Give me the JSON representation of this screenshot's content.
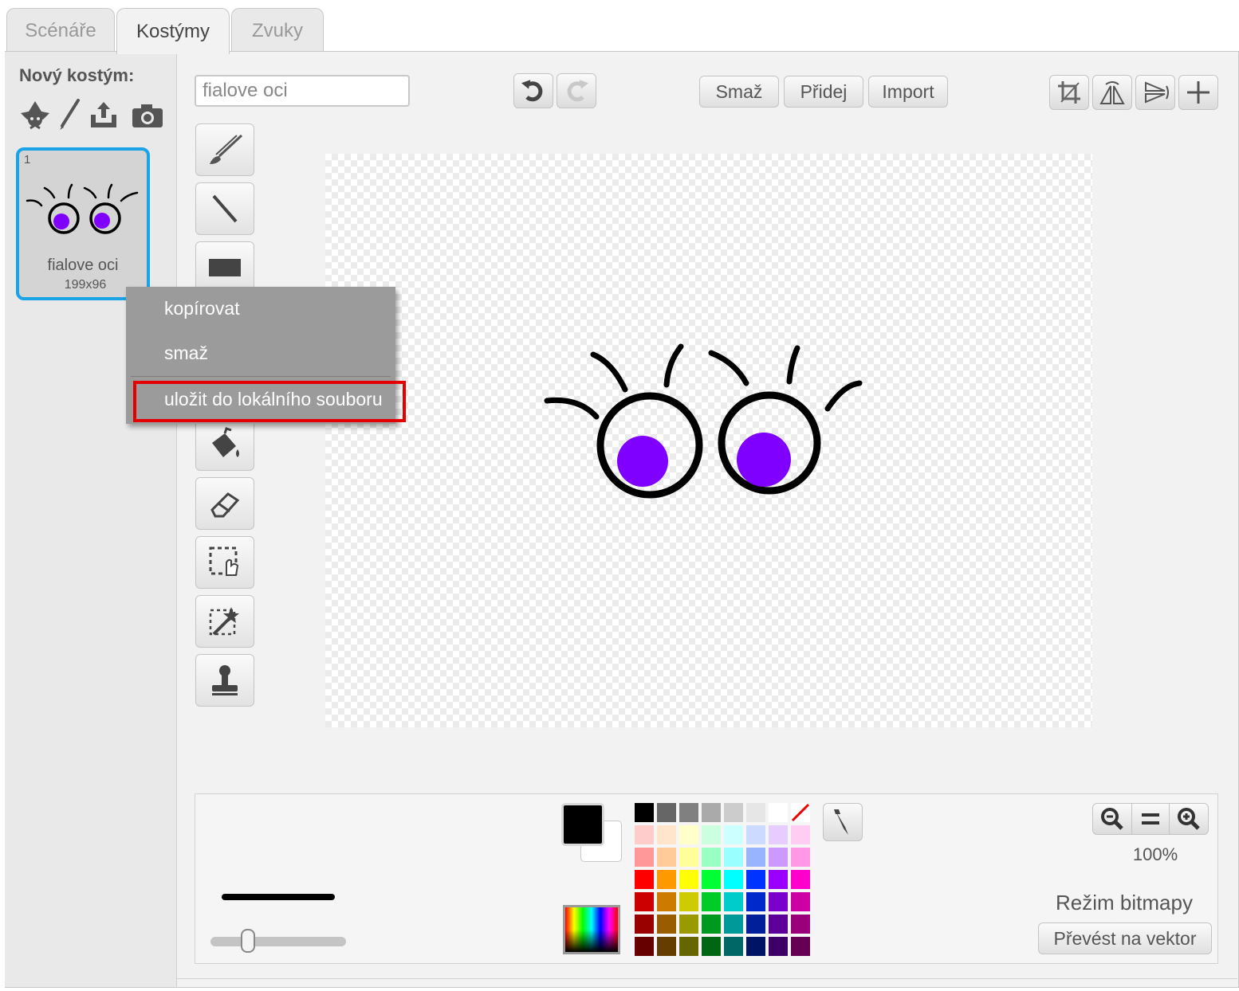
{
  "tabs": [
    {
      "label": "Scénáře"
    },
    {
      "label": "Kostýmy"
    },
    {
      "label": "Zvuky"
    }
  ],
  "new_costume": {
    "label": "Nový kostým:",
    "icons": [
      "sprite-library-icon",
      "paint-brush-icon",
      "upload-icon",
      "camera-icon"
    ]
  },
  "costume": {
    "number": "1",
    "name": "fialove oci",
    "size": "199x96"
  },
  "context_menu": {
    "items": [
      "kopírovat",
      "smaž",
      "uložit do lokálního souboru"
    ]
  },
  "toolbar": {
    "costume_name_value": "fialove oci",
    "clear_label": "Smaž",
    "add_label": "Přidej",
    "import_label": "Import"
  },
  "tools": [
    "brush-icon",
    "line-icon",
    "rectangle-icon",
    "ellipse-icon",
    "text-icon",
    "fill-icon",
    "eraser-icon",
    "select-icon",
    "magic-select-icon",
    "stamp-icon"
  ],
  "bottom": {
    "zoom": "100%",
    "mode_label": "Režim bitmapy",
    "convert_label": "Převést na vektor",
    "primary_color": "#000000",
    "secondary_color": "#ffffff"
  },
  "palette": [
    [
      "#000000",
      "#666666",
      "#808080",
      "#aaaaaa",
      "#cccccc",
      "#e6e6e6",
      "#ffffff",
      "none"
    ],
    [
      "#ffcccc",
      "#ffe5cc",
      "#ffffcc",
      "#ccffe0",
      "#ccffff",
      "#ccdaff",
      "#e6ccff",
      "#ffccf2"
    ],
    [
      "#ff9999",
      "#ffcc99",
      "#ffff99",
      "#99ffc2",
      "#99ffff",
      "#99b4ff",
      "#cc99ff",
      "#ff99e6"
    ],
    [
      "#ff0000",
      "#ff9900",
      "#ffff00",
      "#00ff33",
      "#00ffff",
      "#0033ff",
      "#9900ff",
      "#ff00cc"
    ],
    [
      "#cc0000",
      "#cc7a00",
      "#cccc00",
      "#00cc29",
      "#00cccc",
      "#0029cc",
      "#7a00cc",
      "#cc00a3"
    ],
    [
      "#990000",
      "#995c00",
      "#999900",
      "#00991f",
      "#009999",
      "#001f99",
      "#5c0099",
      "#99007a"
    ],
    [
      "#660000",
      "#663d00",
      "#666600",
      "#006614",
      "#006666",
      "#001466",
      "#3d0066",
      "#660052"
    ]
  ]
}
